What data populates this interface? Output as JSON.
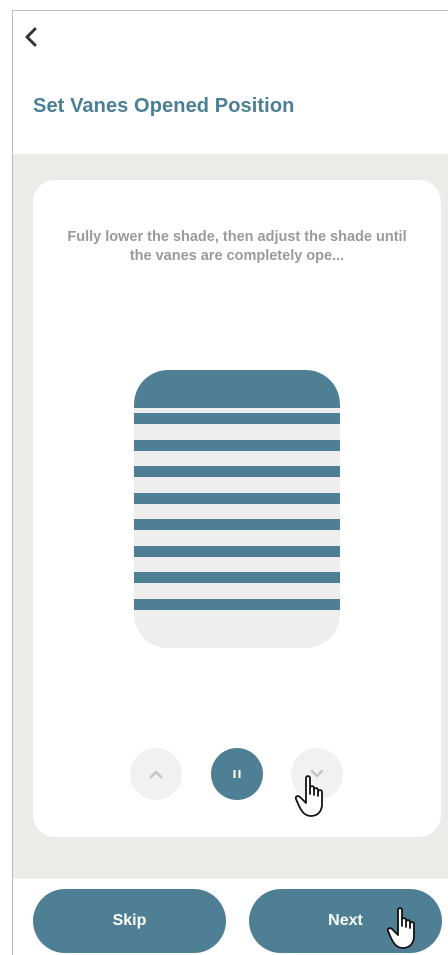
{
  "header": {
    "back_icon": "chevron-left-icon",
    "title": "Set Vanes Opened Position"
  },
  "card": {
    "instruction": "Fully lower the shade, then adjust the shade until the vanes are completely ope..."
  },
  "shade": {
    "vane_count": 8
  },
  "controls": {
    "up_icon": "chevron-up-icon",
    "pause_icon": "pause-icon",
    "down_icon": "chevron-down-icon"
  },
  "footer": {
    "skip_label": "Skip",
    "next_label": "Next"
  },
  "colors": {
    "accent": "#4e7f95",
    "title": "#4a7f95",
    "background": "#ebebe8",
    "instruction_text": "#9a9a9a"
  }
}
